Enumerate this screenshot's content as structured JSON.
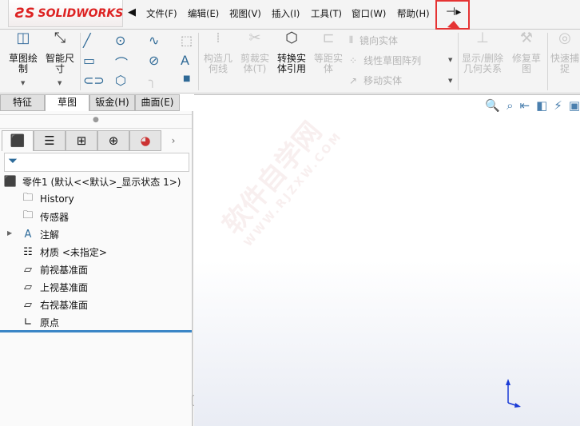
{
  "app": {
    "logo_text": "SOLIDWORKS",
    "logo_mark": "DS"
  },
  "menu": [
    "文件(F)",
    "编辑(E)",
    "视图(V)",
    "插入(I)",
    "工具(T)",
    "窗口(W)",
    "帮助(H)"
  ],
  "toolbar": {
    "sketch": "草图绘制",
    "smart_dim": "智能尺寸",
    "construction": "构造几何线",
    "trim": "剪裁实体(T)",
    "convert": "转换实体引用",
    "offset": "等距实体",
    "mirror": "镜向实体",
    "linear_pattern": "线性草图阵列",
    "move": "移动实体",
    "relations": "显示/删除几何关系",
    "repair": "修复草图",
    "quick_snap": "快速捕捉"
  },
  "tabs": [
    "特征",
    "草图",
    "钣金(H)",
    "曲面(E)"
  ],
  "active_tab": 1,
  "tree": {
    "root": "零件1 (默认<<默认>_显示状态 1>)",
    "items": [
      "History",
      "传感器",
      "注解",
      "材质 <未指定>",
      "前视基准面",
      "上视基准面",
      "右视基准面",
      "原点"
    ]
  },
  "watermark": {
    "main": "软件自学网",
    "sub": "WWW.RJZXW.COM"
  },
  "colors": {
    "highlight": "#e53333",
    "accent": "#3b86c6"
  }
}
